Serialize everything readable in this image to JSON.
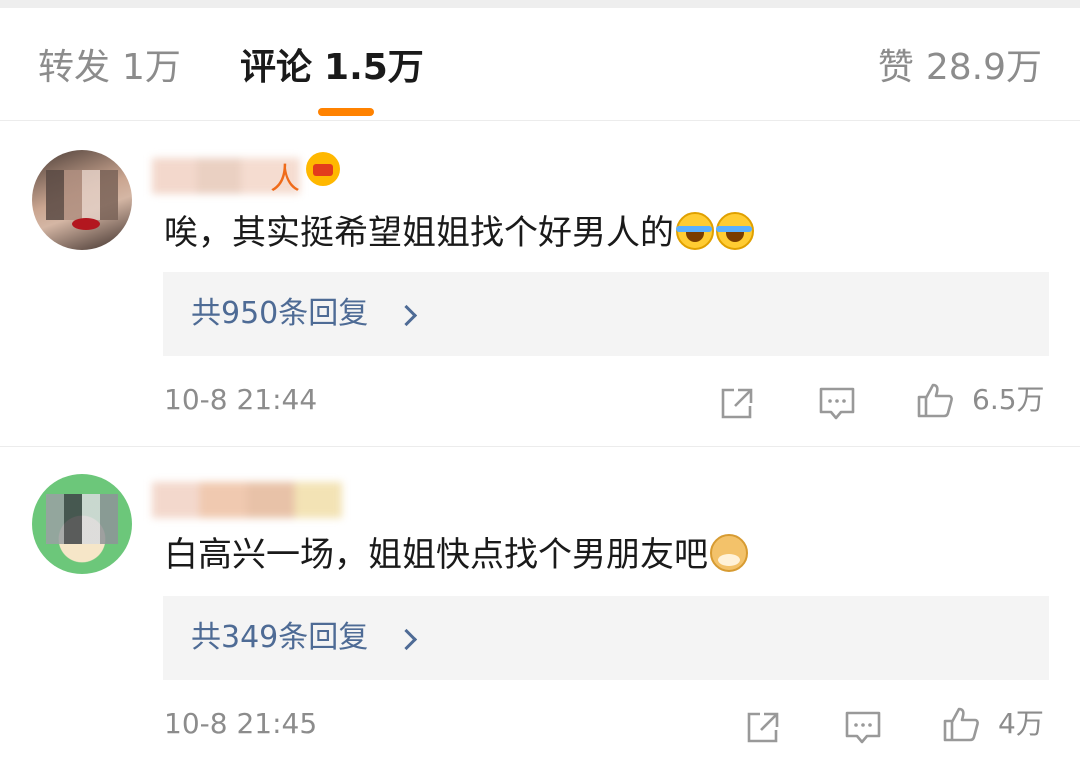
{
  "tabs": [
    {
      "label": "转发",
      "count": "1万"
    },
    {
      "label": "评论",
      "count": "1.5万"
    },
    {
      "label": "赞",
      "count": "28.9万"
    }
  ],
  "comments": [
    {
      "name_suffix": "人",
      "text": "唉，其实挺希望姐姐找个好男人的",
      "emoji": "laugh-cry",
      "replies": "共950条回复",
      "time": "10-8 21:44",
      "likes": "6.5万"
    },
    {
      "text": "白高兴一场，姐姐快点找个男朋友吧",
      "emoji": "doge",
      "replies": "共349条回复",
      "time": "10-8 21:45",
      "likes": "4万"
    }
  ]
}
